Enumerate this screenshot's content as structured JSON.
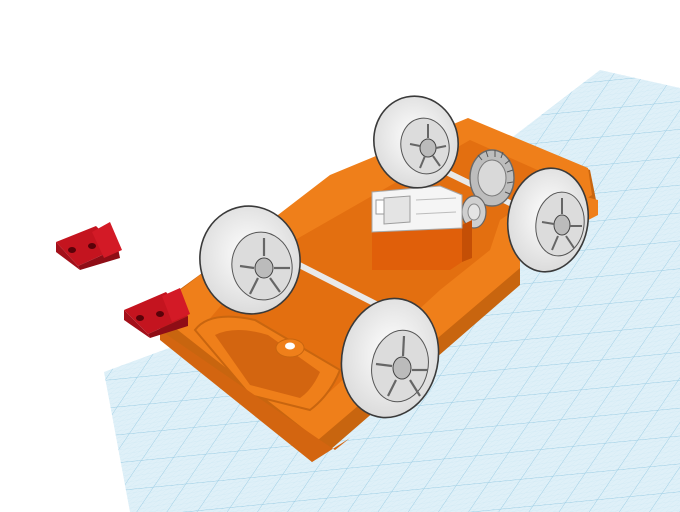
{
  "scene": {
    "background_color": "#ffffff",
    "workplane": {
      "major_grid_color": "#8fc6e0",
      "minor_grid_color": "#c5e4f1",
      "fill_color": "#dff0f8"
    },
    "colors": {
      "chassis": "#ef7f1a",
      "chassis_dark": "#c8650f",
      "tire": "#f2f2f2",
      "tire_edge": "#3a3a3a",
      "rim": "#dcdcdc",
      "axle": "#e9e9e9",
      "motor_body": "#e05f0a",
      "motor_cap": "#f5f5f5",
      "gear": "#b9b9b9",
      "bracket": "#c4141f",
      "bracket_dark": "#8f0d16"
    },
    "objects": [
      {
        "name": "chassis",
        "icon": "chassis-icon"
      },
      {
        "name": "front-left-wheel",
        "icon": "wheel-icon"
      },
      {
        "name": "front-right-wheel",
        "icon": "wheel-icon"
      },
      {
        "name": "rear-left-wheel",
        "icon": "wheel-icon"
      },
      {
        "name": "rear-right-wheel",
        "icon": "wheel-icon"
      },
      {
        "name": "motor",
        "icon": "motor-icon"
      },
      {
        "name": "crown-gear",
        "icon": "gear-icon"
      },
      {
        "name": "bracket-1",
        "icon": "bracket-icon"
      },
      {
        "name": "bracket-2",
        "icon": "bracket-icon"
      }
    ]
  }
}
